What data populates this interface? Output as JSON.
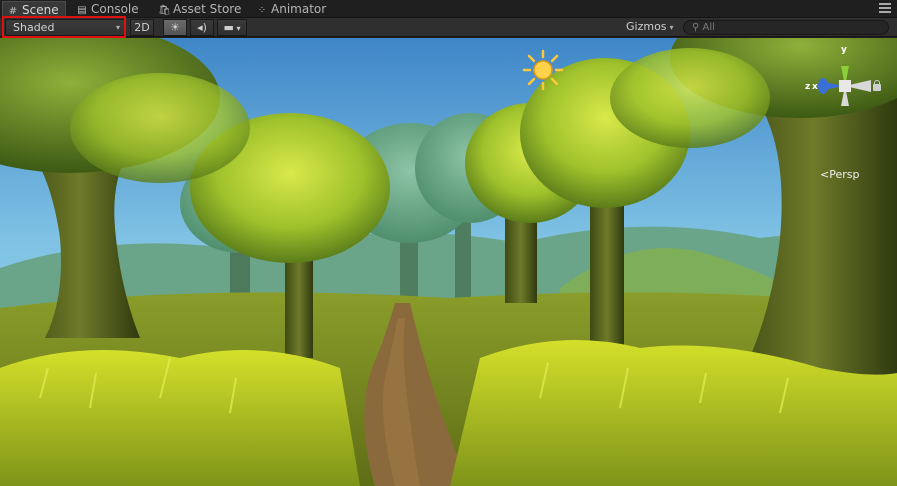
{
  "tabs": [
    {
      "label": "Scene",
      "icon": "scene-icon",
      "active": true
    },
    {
      "label": "Console",
      "icon": "console-icon",
      "active": false
    },
    {
      "label": "Asset Store",
      "icon": "asset-store-icon",
      "active": false
    },
    {
      "label": "Animator",
      "icon": "animator-icon",
      "active": false
    }
  ],
  "toolbar": {
    "draw_mode": "Shaded",
    "mode_2d": "2D",
    "lighting_icon": "sun-icon",
    "audio_icon": "speaker-icon",
    "effects_icon": "image-icon",
    "gizmos_label": "Gizmos",
    "search_placeholder": "All"
  },
  "gizmo": {
    "x_label": "x",
    "y_label": "y",
    "z_label": "z",
    "projection_label": "Persp"
  },
  "colors": {
    "highlight": "#e01010",
    "axis_x": "#c0392b",
    "axis_y": "#8ccf3a",
    "axis_z": "#3a6fd8"
  }
}
